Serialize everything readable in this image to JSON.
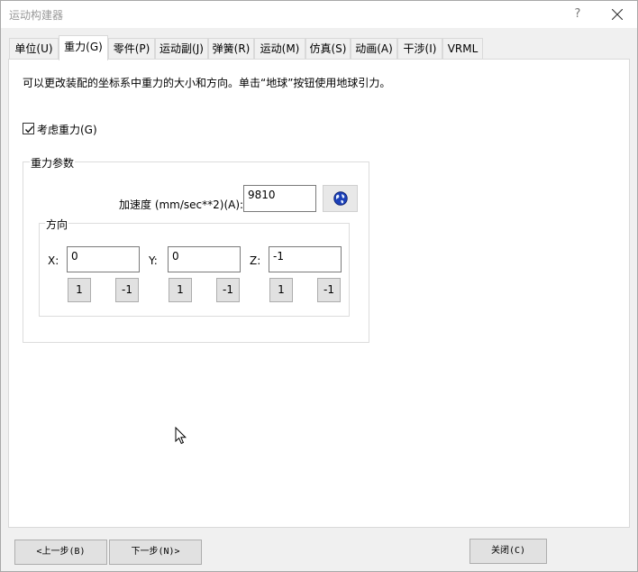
{
  "window": {
    "title": "运动构建器",
    "help_label": "?"
  },
  "tabs": [
    {
      "label": "单位(U)",
      "active": false
    },
    {
      "label": "重力(G)",
      "active": true
    },
    {
      "label": "零件(P)",
      "active": false
    },
    {
      "label": "运动副(J)",
      "active": false
    },
    {
      "label": "弹簧(R)",
      "active": false
    },
    {
      "label": "运动(M)",
      "active": false
    },
    {
      "label": "仿真(S)",
      "active": false
    },
    {
      "label": "动画(A)",
      "active": false
    },
    {
      "label": "干涉(I)",
      "active": false
    },
    {
      "label": "VRML",
      "active": false
    }
  ],
  "gravity": {
    "description": "可以更改装配的坐标系中重力的大小和方向。单击“地球”按钮使用地球引力。",
    "consider_gravity": {
      "label": "考虑重力(G)",
      "checked": true
    },
    "params_group_label": "重力参数",
    "acceleration": {
      "label": "加速度 (mm/sec**2)(A):",
      "value": "9810"
    },
    "globe_button_icon": "globe-icon",
    "direction": {
      "group_label": "方向",
      "x": {
        "label": "X:",
        "value": "0",
        "plus": "1",
        "minus": "-1"
      },
      "y": {
        "label": "Y:",
        "value": "0",
        "plus": "1",
        "minus": "-1"
      },
      "z": {
        "label": "Z:",
        "value": "-1",
        "plus": "1",
        "minus": "-1"
      }
    }
  },
  "footer": {
    "prev_label": "<上一步(B)",
    "next_label": "下一步(N)>",
    "close_label": "关闭(C)"
  }
}
